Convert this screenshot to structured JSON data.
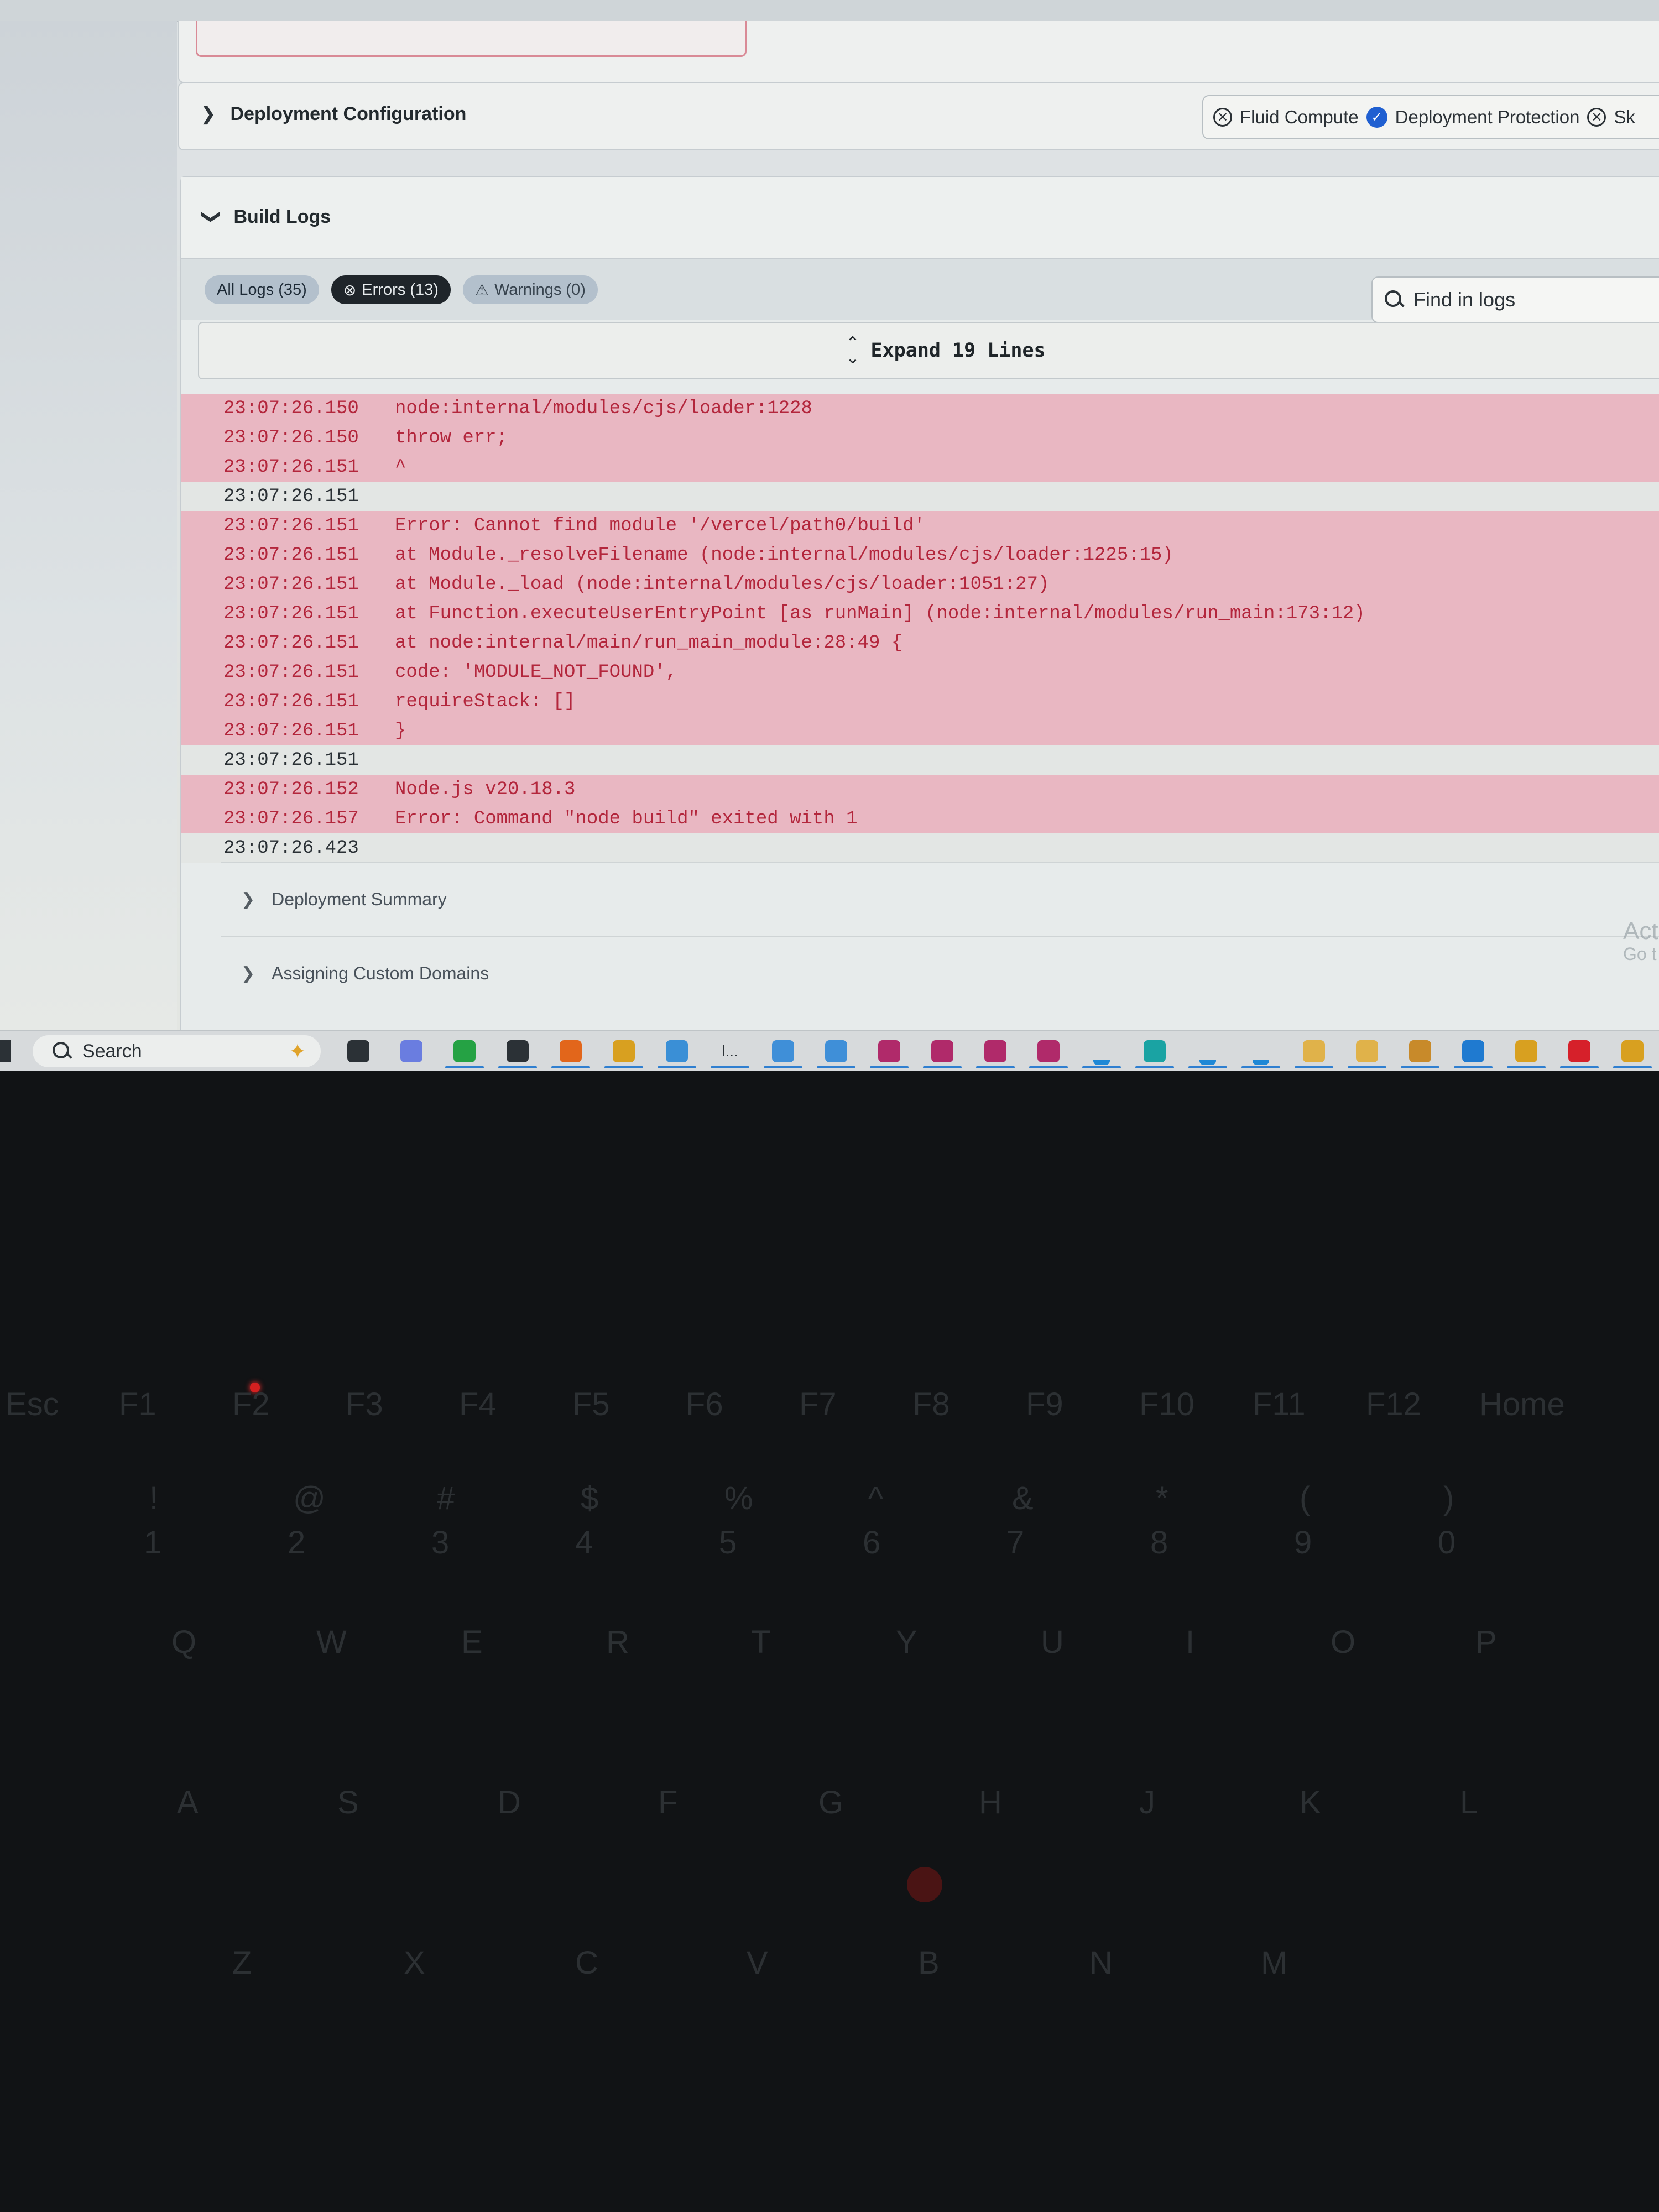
{
  "deployment_configuration": {
    "title": "Deployment Configuration",
    "chips": [
      {
        "label": "Fluid Compute",
        "icon": "x-circle-icon"
      },
      {
        "label": "Deployment Protection",
        "icon": "check-circle-icon"
      },
      {
        "label": "Sk",
        "icon": "x-circle-icon"
      }
    ]
  },
  "build_logs": {
    "title": "Build Logs",
    "filters": {
      "all": "All Logs (35)",
      "errors": "Errors (13)",
      "warnings": "Warnings (0)"
    },
    "search_placeholder": "Find in logs",
    "expand_label": "Expand 19 Lines",
    "lines": [
      {
        "time": "23:07:26.150",
        "text": "node:internal/modules/cjs/loader:1228",
        "level": "error"
      },
      {
        "time": "23:07:26.150",
        "text": "throw err;",
        "level": "error"
      },
      {
        "time": "23:07:26.151",
        "text": "^",
        "level": "error"
      },
      {
        "time": "23:07:26.151",
        "text": "",
        "level": "info"
      },
      {
        "time": "23:07:26.151",
        "text": "Error: Cannot find module '/vercel/path0/build'",
        "level": "error"
      },
      {
        "time": "23:07:26.151",
        "text": "at Module._resolveFilename (node:internal/modules/cjs/loader:1225:15)",
        "level": "error"
      },
      {
        "time": "23:07:26.151",
        "text": "at Module._load (node:internal/modules/cjs/loader:1051:27)",
        "level": "error"
      },
      {
        "time": "23:07:26.151",
        "text": "at Function.executeUserEntryPoint [as runMain] (node:internal/modules/run_main:173:12)",
        "level": "error"
      },
      {
        "time": "23:07:26.151",
        "text": "at node:internal/main/run_main_module:28:49 {",
        "level": "error"
      },
      {
        "time": "23:07:26.151",
        "text": "code: 'MODULE_NOT_FOUND',",
        "level": "error"
      },
      {
        "time": "23:07:26.151",
        "text": "requireStack: []",
        "level": "error"
      },
      {
        "time": "23:07:26.151",
        "text": "}",
        "level": "error"
      },
      {
        "time": "23:07:26.151",
        "text": "",
        "level": "info"
      },
      {
        "time": "23:07:26.152",
        "text": "Node.js v20.18.3",
        "level": "error"
      },
      {
        "time": "23:07:26.157",
        "text": "Error: Command \"node build\" exited with 1",
        "level": "error"
      },
      {
        "time": "23:07:26.423",
        "text": "",
        "level": "info"
      }
    ],
    "sections": [
      {
        "title": "Deployment Summary"
      },
      {
        "title": "Assigning Custom Domains"
      }
    ]
  },
  "watermark": {
    "line1": "Act",
    "line2": "Go t"
  },
  "taskbar": {
    "search_label": "Search",
    "pinned_text": "l...",
    "icons": [
      "task-view-icon",
      "copilot-icon",
      "whatsapp-icon",
      "terminal-icon",
      "firefox-icon",
      "chrome-icon",
      "chrome-profile-icon",
      "app-icon",
      "notepad-icon",
      "notepad-icon",
      "winrar-icon",
      "winrar-icon",
      "winrar-icon",
      "winrar-icon",
      "download-icon",
      "box-icon",
      "download-icon",
      "download-icon",
      "file-icon",
      "file-icon",
      "archive-icon",
      "vscode-icon",
      "chrome-icon",
      "opera-icon",
      "chrome-icon"
    ]
  },
  "keyboard": {
    "fn_row": [
      "Esc",
      "F1",
      "F2",
      "F3",
      "F4",
      "F5",
      "F6",
      "F7",
      "F8",
      "F9",
      "F10",
      "F11",
      "F12",
      "Home"
    ],
    "num_row": [
      "!",
      "@",
      "#",
      "$",
      "%",
      "^",
      "&",
      "*",
      "(",
      ")"
    ],
    "num_digits": [
      "1",
      "2",
      "3",
      "4",
      "5",
      "6",
      "7",
      "8",
      "9",
      "0"
    ],
    "row_q": [
      "Q",
      "W",
      "E",
      "R",
      "T",
      "Y",
      "U",
      "I",
      "O",
      "P"
    ],
    "row_a": [
      "A",
      "S",
      "D",
      "F",
      "G",
      "H",
      "J",
      "K",
      "L"
    ],
    "row_z": [
      "Z",
      "X",
      "C",
      "V",
      "B",
      "N",
      "M"
    ]
  },
  "colors": {
    "error_bg": "#e9b7c2",
    "error_text": "#b3263c",
    "accent_blue": "#1f5fd1",
    "filter_dark": "#1f252a"
  }
}
